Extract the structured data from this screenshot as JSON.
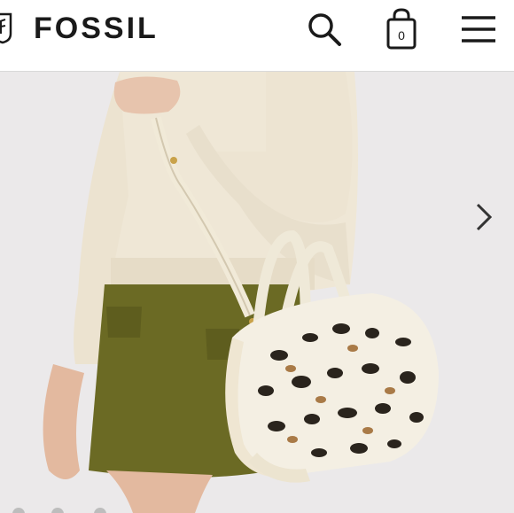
{
  "header": {
    "brand": "FOSSIL",
    "bag_count": "0",
    "icons": {
      "logo": "fossil-shield-logo",
      "search": "search-icon",
      "bag": "shopping-bag-icon",
      "menu": "hamburger-menu-icon"
    }
  },
  "carousel": {
    "next_icon": "chevron-right-icon",
    "slide_count": 3,
    "active_slide": 1
  },
  "colors": {
    "accent_text": "#1a1a1a",
    "background": "#ffffff"
  }
}
